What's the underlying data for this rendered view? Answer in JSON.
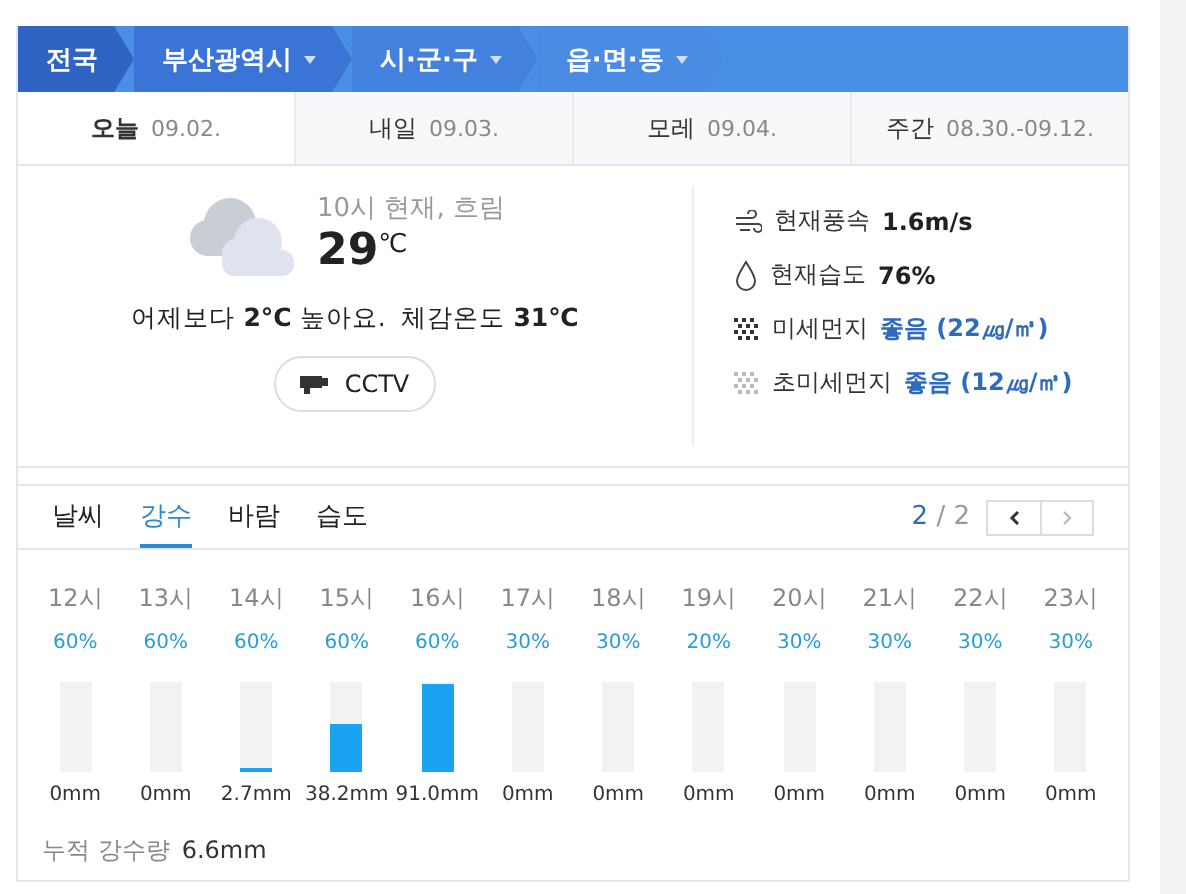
{
  "breadcrumb": [
    {
      "label": "전국",
      "dropdown": false
    },
    {
      "label": "부산광역시",
      "dropdown": true
    },
    {
      "label": "시·군·구",
      "dropdown": true
    },
    {
      "label": "읍·면·동",
      "dropdown": true
    }
  ],
  "days": [
    {
      "label": "오늘",
      "date": "09.02.",
      "selected": true
    },
    {
      "label": "내일",
      "date": "09.03.",
      "selected": false
    },
    {
      "label": "모레",
      "date": "09.04.",
      "selected": false
    },
    {
      "label": "주간",
      "date": "08.30.-09.12.",
      "selected": false
    }
  ],
  "current": {
    "status": "10시 현재, 흐림",
    "temperature": "29",
    "unit": "℃",
    "summary": "어제보다 **2°C** 높아요.  체감온도 **31℃**",
    "cctv": "CCTV"
  },
  "details": [
    {
      "kind": "wind",
      "label": "현재풍속",
      "value": "1.6m/s"
    },
    {
      "kind": "humidity",
      "label": "현재습도",
      "value": "76%"
    },
    {
      "kind": "dust",
      "label": "미세먼지",
      "value": "좋음 (22㎍/㎥)"
    },
    {
      "kind": "finedust",
      "label": "초미세먼지",
      "value": "좋음 (12㎍/㎥)"
    }
  ],
  "tabs": [
    {
      "label": "날씨",
      "selected": false
    },
    {
      "label": "강수",
      "selected": true
    },
    {
      "label": "바람",
      "selected": false
    },
    {
      "label": "습도",
      "selected": false
    }
  ],
  "pager": {
    "current": "2",
    "separator": "/",
    "total": "2"
  },
  "hours": [
    {
      "hour": "12시",
      "chance": "60%",
      "amount": "0mm"
    },
    {
      "hour": "13시",
      "chance": "60%",
      "amount": "0mm"
    },
    {
      "hour": "14시",
      "chance": "60%",
      "amount": "2.7mm",
      "level": 0.05
    },
    {
      "hour": "15시",
      "chance": "60%",
      "amount": "38.2mm",
      "level": 0.55
    },
    {
      "hour": "16시",
      "chance": "60%",
      "amount": "91.0mm",
      "level": 1
    },
    {
      "hour": "17시",
      "chance": "30%",
      "amount": "0mm"
    },
    {
      "hour": "18시",
      "chance": "30%",
      "amount": "0mm"
    },
    {
      "hour": "19시",
      "chance": "20%",
      "amount": "0mm"
    },
    {
      "hour": "20시",
      "chance": "30%",
      "amount": "0mm"
    },
    {
      "hour": "21시",
      "chance": "30%",
      "amount": "0mm"
    },
    {
      "hour": "22시",
      "chance": "30%",
      "amount": "0mm"
    },
    {
      "hour": "23시",
      "chance": "30%",
      "amount": "0mm"
    }
  ],
  "total": {
    "label": "누적 강수량",
    "value": "6.6mm"
  }
}
